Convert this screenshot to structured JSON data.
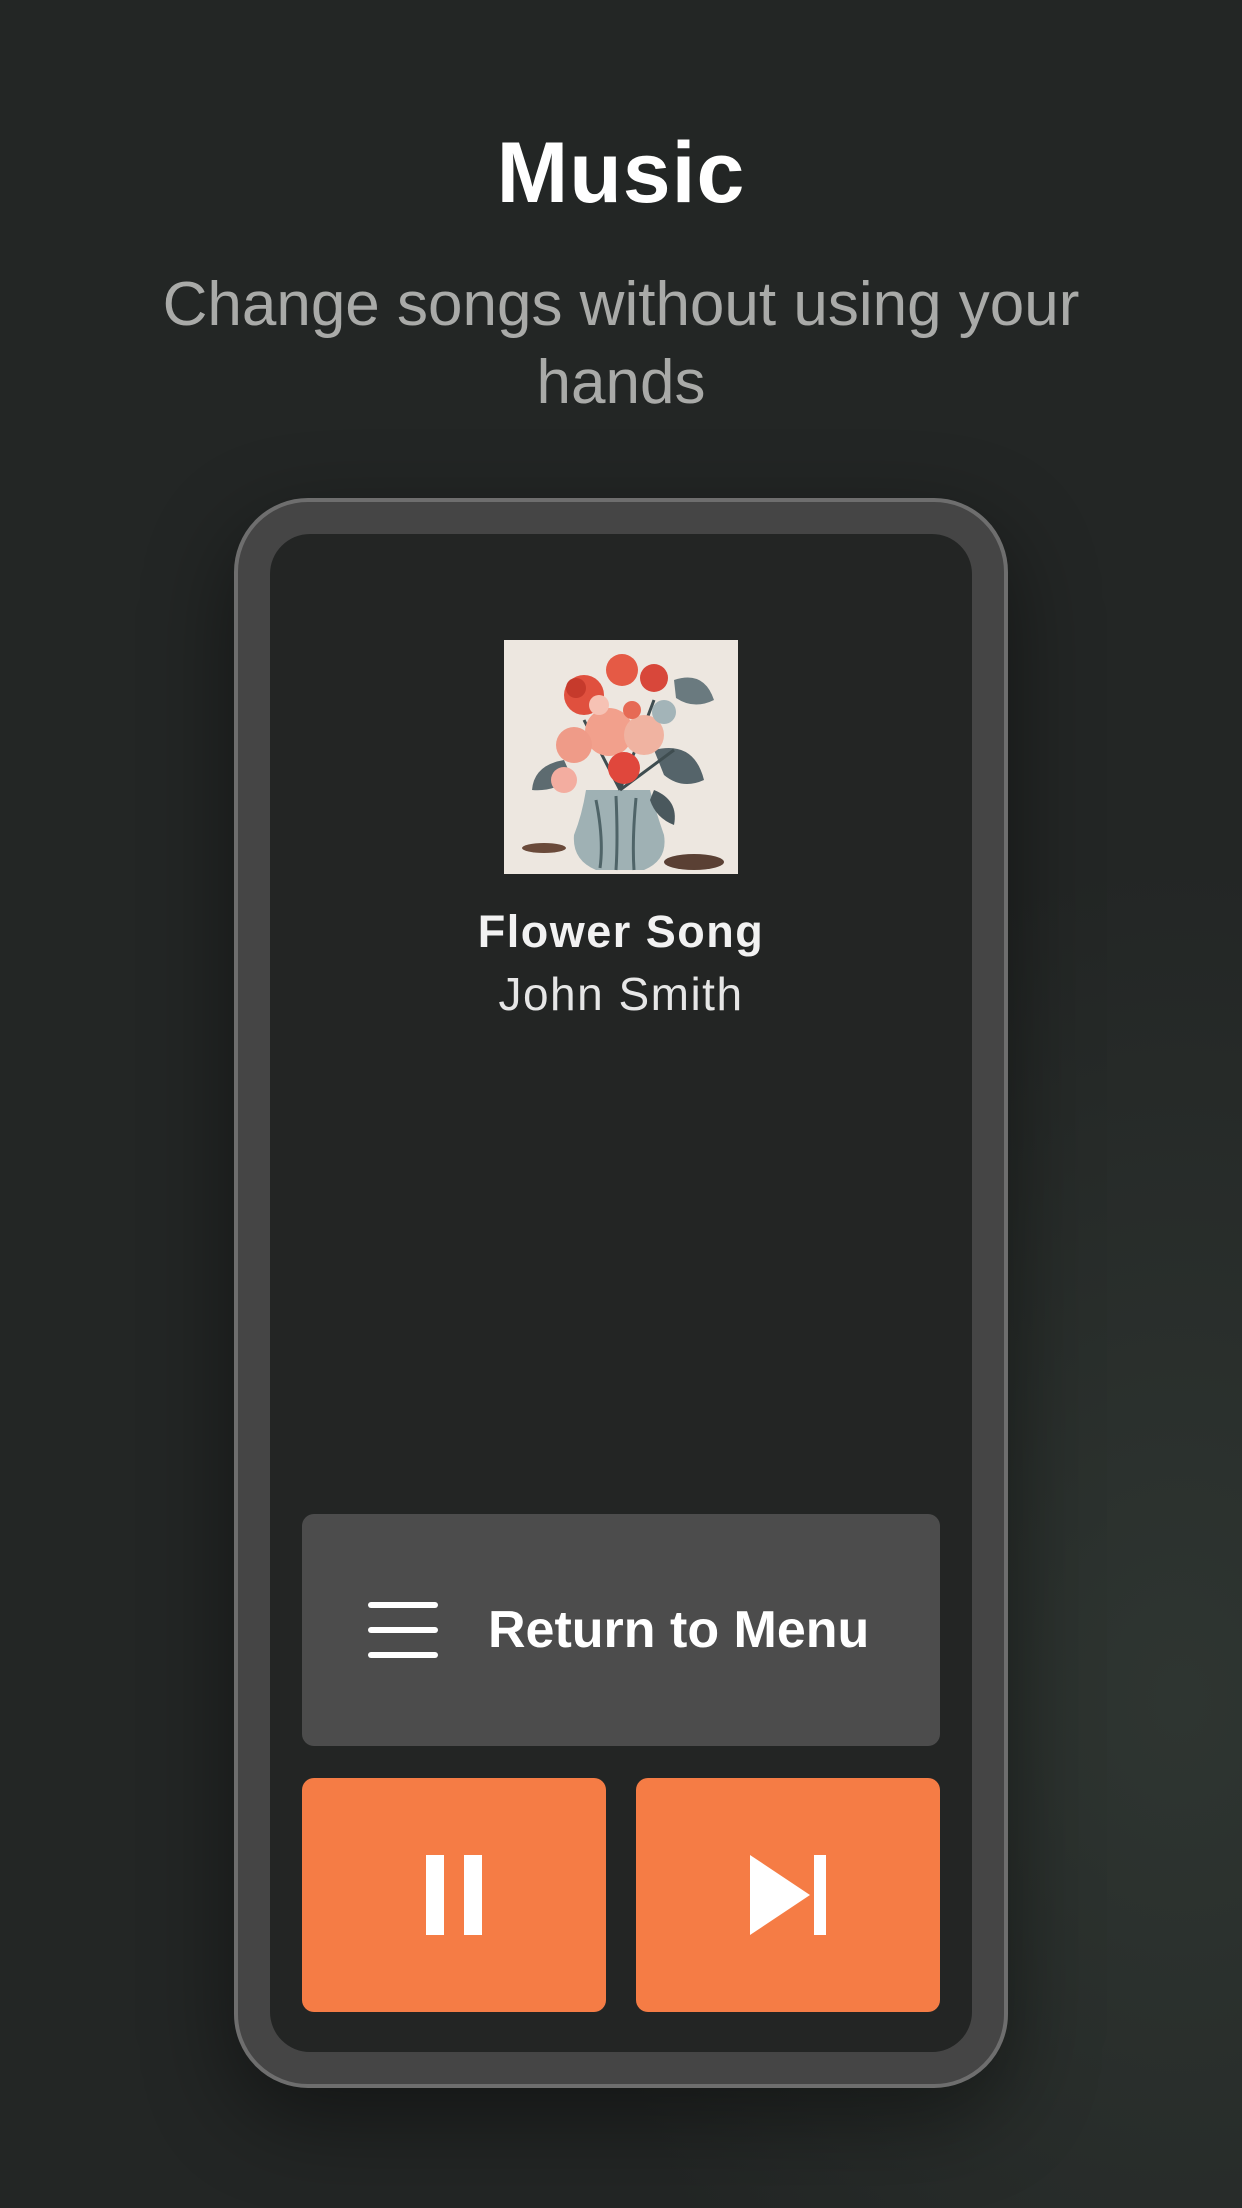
{
  "header": {
    "title": "Music",
    "subtitle": "Change songs without using your hands"
  },
  "player": {
    "album_art_icon": "flower-bouquet-artwork",
    "song_title": "Flower Song",
    "artist": "John Smith"
  },
  "controls": {
    "menu_label": "Return to Menu",
    "menu_icon": "hamburger-menu-icon",
    "pause_icon": "pause-icon",
    "next_icon": "skip-next-icon"
  },
  "colors": {
    "background": "#232625",
    "accent": "#f57c45",
    "menu_button": "#4c4c4c"
  }
}
